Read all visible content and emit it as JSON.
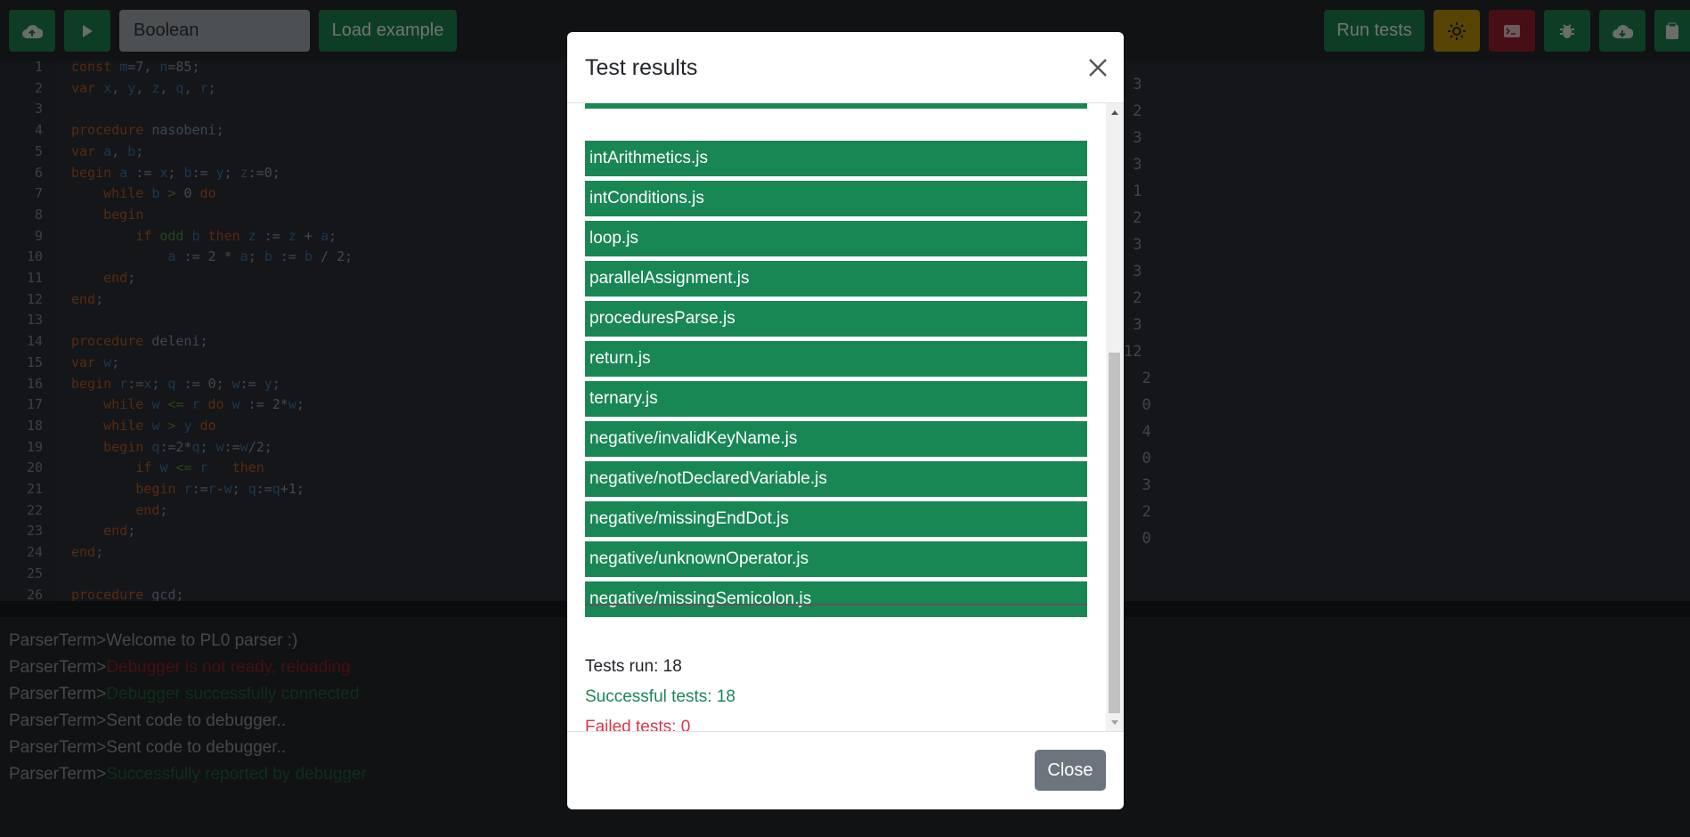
{
  "toolbar": {
    "dropdown_value": "Boolean",
    "load_example_label": "Load example",
    "run_tests_label": "Run tests"
  },
  "editor": {
    "lines": [
      {
        "n": "1",
        "parts": [
          [
            "kw",
            "const "
          ],
          [
            "id",
            "m"
          ],
          [
            "",
            "=7, "
          ],
          [
            "id",
            "n"
          ],
          [
            "",
            "=85;"
          ]
        ]
      },
      {
        "n": "2",
        "parts": [
          [
            "kw",
            "var "
          ],
          [
            "id",
            "x"
          ],
          [
            "",
            ", "
          ],
          [
            "id",
            "y"
          ],
          [
            "",
            ", "
          ],
          [
            "id",
            "z"
          ],
          [
            "",
            ", "
          ],
          [
            "id",
            "q"
          ],
          [
            "",
            ", "
          ],
          [
            "id",
            "r"
          ],
          [
            "",
            ";"
          ]
        ]
      },
      {
        "n": "3",
        "parts": []
      },
      {
        "n": "4",
        "parts": [
          [
            "kw",
            "procedure "
          ],
          [
            "fn",
            "nasobeni"
          ],
          [
            "",
            ";"
          ]
        ]
      },
      {
        "n": "5",
        "parts": [
          [
            "kw",
            "var "
          ],
          [
            "id",
            "a"
          ],
          [
            "",
            ", "
          ],
          [
            "id",
            "b"
          ],
          [
            "",
            ";"
          ]
        ]
      },
      {
        "n": "6",
        "parts": [
          [
            "kw",
            "begin "
          ],
          [
            "id",
            "a"
          ],
          [
            "",
            " := "
          ],
          [
            "id",
            "x"
          ],
          [
            "",
            "; "
          ],
          [
            "id",
            "b"
          ],
          [
            "",
            ":= "
          ],
          [
            "id",
            "y"
          ],
          [
            "",
            "; "
          ],
          [
            "id",
            "z"
          ],
          [
            "",
            ":=0;"
          ]
        ]
      },
      {
        "n": "7",
        "parts": [
          [
            "",
            "    "
          ],
          [
            "kw",
            "while "
          ],
          [
            "id",
            "b"
          ],
          [
            "",
            " "
          ],
          [
            "gr",
            ">"
          ],
          [
            "",
            " 0 "
          ],
          [
            "kw",
            "do"
          ]
        ]
      },
      {
        "n": "8",
        "parts": [
          [
            "",
            "    "
          ],
          [
            "kw",
            "begin"
          ]
        ]
      },
      {
        "n": "9",
        "parts": [
          [
            "",
            "        "
          ],
          [
            "kw",
            "if "
          ],
          [
            "gr",
            "odd "
          ],
          [
            "id",
            "b"
          ],
          [
            "",
            " "
          ],
          [
            "kw",
            "then "
          ],
          [
            "id",
            "z"
          ],
          [
            "",
            " := "
          ],
          [
            "id",
            "z"
          ],
          [
            "",
            " + "
          ],
          [
            "id",
            "a"
          ],
          [
            "",
            ";"
          ]
        ]
      },
      {
        "n": "10",
        "parts": [
          [
            "",
            "            "
          ],
          [
            "id",
            "a"
          ],
          [
            "",
            " := 2 * "
          ],
          [
            "id",
            "a"
          ],
          [
            "",
            "; "
          ],
          [
            "id",
            "b"
          ],
          [
            "",
            " := "
          ],
          [
            "id",
            "b"
          ],
          [
            "",
            " / 2;"
          ]
        ]
      },
      {
        "n": "11",
        "parts": [
          [
            "",
            "    "
          ],
          [
            "kw",
            "end"
          ],
          [
            "",
            ";"
          ]
        ]
      },
      {
        "n": "12",
        "parts": [
          [
            "kw",
            "end"
          ],
          [
            "",
            ";"
          ]
        ]
      },
      {
        "n": "13",
        "parts": []
      },
      {
        "n": "14",
        "parts": [
          [
            "kw",
            "procedure "
          ],
          [
            "fn",
            "deleni"
          ],
          [
            "",
            ";"
          ]
        ]
      },
      {
        "n": "15",
        "parts": [
          [
            "kw",
            "var "
          ],
          [
            "id",
            "w"
          ],
          [
            "",
            ";"
          ]
        ]
      },
      {
        "n": "16",
        "parts": [
          [
            "kw",
            "begin "
          ],
          [
            "id",
            "r"
          ],
          [
            "",
            ":="
          ],
          [
            "id",
            "x"
          ],
          [
            "",
            "; "
          ],
          [
            "id",
            "q"
          ],
          [
            "",
            " := 0; "
          ],
          [
            "id",
            "w"
          ],
          [
            "",
            ":= "
          ],
          [
            "id",
            "y"
          ],
          [
            "",
            ";"
          ]
        ]
      },
      {
        "n": "17",
        "parts": [
          [
            "",
            "    "
          ],
          [
            "kw",
            "while "
          ],
          [
            "id",
            "w"
          ],
          [
            "",
            " "
          ],
          [
            "gr",
            "<="
          ],
          [
            "",
            " "
          ],
          [
            "id",
            "r"
          ],
          [
            "",
            " "
          ],
          [
            "kw",
            "do "
          ],
          [
            "id",
            "w"
          ],
          [
            "",
            " := 2*"
          ],
          [
            "id",
            "w"
          ],
          [
            "",
            ";"
          ]
        ]
      },
      {
        "n": "18",
        "parts": [
          [
            "",
            "    "
          ],
          [
            "kw",
            "while "
          ],
          [
            "id",
            "w"
          ],
          [
            "",
            " "
          ],
          [
            "gr",
            ">"
          ],
          [
            "",
            " "
          ],
          [
            "id",
            "y"
          ],
          [
            "",
            " "
          ],
          [
            "kw",
            "do"
          ]
        ]
      },
      {
        "n": "19",
        "parts": [
          [
            "",
            "    "
          ],
          [
            "kw",
            "begin "
          ],
          [
            "id",
            "q"
          ],
          [
            "",
            ":=2*"
          ],
          [
            "id",
            "q"
          ],
          [
            "",
            "; "
          ],
          [
            "id",
            "w"
          ],
          [
            "",
            ":="
          ],
          [
            "id",
            "w"
          ],
          [
            "",
            "/2;"
          ]
        ]
      },
      {
        "n": "20",
        "parts": [
          [
            "",
            "        "
          ],
          [
            "kw",
            "if "
          ],
          [
            "id",
            "w"
          ],
          [
            "",
            " "
          ],
          [
            "gr",
            "<="
          ],
          [
            "",
            " "
          ],
          [
            "id",
            "r"
          ],
          [
            "",
            "   "
          ],
          [
            "kw",
            "then"
          ]
        ]
      },
      {
        "n": "21",
        "parts": [
          [
            "",
            "        "
          ],
          [
            "kw",
            "begin "
          ],
          [
            "id",
            "r"
          ],
          [
            "",
            ":="
          ],
          [
            "id",
            "r"
          ],
          [
            "",
            "-"
          ],
          [
            "id",
            "w"
          ],
          [
            "",
            "; "
          ],
          [
            "id",
            "q"
          ],
          [
            "",
            ":="
          ],
          [
            "id",
            "q"
          ],
          [
            "",
            "+1;"
          ]
        ]
      },
      {
        "n": "22",
        "parts": [
          [
            "",
            "        "
          ],
          [
            "kw",
            "end"
          ],
          [
            "",
            ";"
          ]
        ]
      },
      {
        "n": "23",
        "parts": [
          [
            "",
            "    "
          ],
          [
            "kw",
            "end"
          ],
          [
            "",
            ";"
          ]
        ]
      },
      {
        "n": "24",
        "parts": [
          [
            "kw",
            "end"
          ],
          [
            "",
            ";"
          ]
        ]
      },
      {
        "n": "25",
        "parts": []
      },
      {
        "n": "26",
        "parts": [
          [
            "kw",
            "procedure "
          ],
          [
            "fn",
            "gcd"
          ],
          [
            "",
            ";"
          ]
        ]
      }
    ],
    "output_values": [
      " 3",
      " 2",
      " 3",
      " 3",
      " 1",
      " 2",
      " 3",
      " 3",
      " 2",
      " 3",
      "12",
      "  2",
      "  0",
      "  4",
      "  0",
      "  3",
      "  2",
      "  0"
    ]
  },
  "terminal": {
    "lines": [
      {
        "prompt": "ParserTerm>",
        "text": "Welcome to PL0 parser :)",
        "tone": ""
      },
      {
        "prompt": "ParserTerm>",
        "text": "Debugger is not ready, reloading",
        "tone": "red"
      },
      {
        "prompt": "ParserTerm>",
        "text": "Debugger successfully connected",
        "tone": "green"
      },
      {
        "prompt": "ParserTerm>",
        "text": "Sent code to debugger..",
        "tone": ""
      },
      {
        "prompt": "ParserTerm>",
        "text": "Sent code to debugger..",
        "tone": ""
      },
      {
        "prompt": "ParserTerm>",
        "text": "Successfully reported by debugger",
        "tone": "green"
      }
    ]
  },
  "modal": {
    "title": "Test results",
    "tests": [
      "intArithmetics.js",
      "intConditions.js",
      "loop.js",
      "parallelAssignment.js",
      "proceduresParse.js",
      "return.js",
      "ternary.js",
      "negative/invalidKeyName.js",
      "negative/notDeclaredVariable.js",
      "negative/missingEndDot.js",
      "negative/unknownOperator.js",
      "negative/missingSemicolon.js"
    ],
    "summary": {
      "tests_run": "Tests run: 18",
      "successful": "Successful tests: 18",
      "failed": "Failed tests: 0"
    },
    "close_label": "Close"
  },
  "colors": {
    "success": "#198754",
    "danger": "#dc3545",
    "warning": "#ffc107",
    "secondary": "#6c757d"
  }
}
